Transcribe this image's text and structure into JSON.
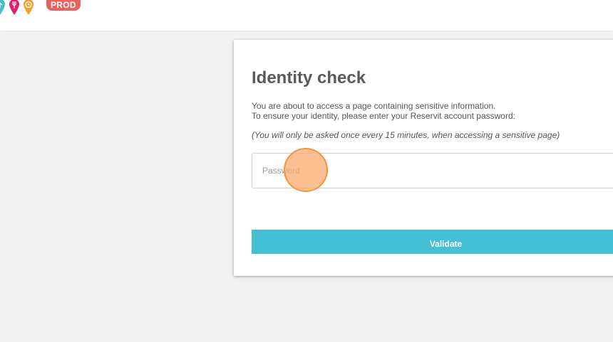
{
  "header": {
    "env_badge": "PROD",
    "pin_icons": [
      {
        "name": "teal-pin-icon",
        "color": "#3fbfd0"
      },
      {
        "name": "magenta-pin-icon",
        "color": "#d9226e"
      },
      {
        "name": "orange-pin-icon",
        "color": "#f0a032"
      }
    ]
  },
  "dialog": {
    "title": "Identity check",
    "desc_line1": "You are about to access a page containing sensitive information.",
    "desc_line2": "To ensure your identity, please enter your Reservit account password:",
    "note": "(You will only be asked once every 15 minutes, when accessing a sensitive page)",
    "password": {
      "placeholder": "Password",
      "value": ""
    },
    "validate_label": "Validate"
  },
  "colors": {
    "accent": "#45bfd3",
    "badge": "#e8625f",
    "background": "#f2f2f2",
    "click_marker": "#f0963c"
  }
}
